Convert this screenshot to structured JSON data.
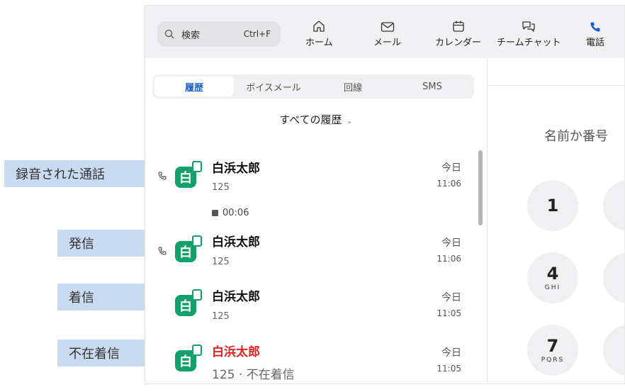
{
  "toolbar": {
    "search_label": "検索",
    "search_shortcut": "Ctrl+F",
    "nav": [
      {
        "label": "ホーム",
        "icon": "home-icon"
      },
      {
        "label": "メール",
        "icon": "mail-icon"
      },
      {
        "label": "カレンダー",
        "icon": "calendar-icon"
      },
      {
        "label": "チームチャット",
        "icon": "chat-icon"
      },
      {
        "label": "電話",
        "icon": "phone-icon",
        "active": true
      }
    ]
  },
  "tabs": [
    {
      "label": "履歴",
      "active": true
    },
    {
      "label": "ボイスメール"
    },
    {
      "label": "回線"
    },
    {
      "label": "SMS"
    }
  ],
  "filter": {
    "label": "すべての履歴"
  },
  "calls": [
    {
      "type": "recorded",
      "avatar_text": "白",
      "name": "白浜太郎",
      "number": "125",
      "day": "今日",
      "time": "11:06",
      "recording": "00:06"
    },
    {
      "type": "outgoing",
      "avatar_text": "白",
      "name": "白浜太郎",
      "number": "125",
      "day": "今日",
      "time": "11:06"
    },
    {
      "type": "incoming",
      "avatar_text": "白",
      "name": "白浜太郎",
      "number": "125",
      "day": "今日",
      "time": "11:05"
    },
    {
      "type": "missed",
      "avatar_text": "白",
      "name": "白浜太郎",
      "number": "125 · 不在着信",
      "day": "今日",
      "time": "11:05"
    }
  ],
  "dialer": {
    "placeholder": "名前か番号",
    "keys": [
      {
        "digit": "1",
        "letters": ""
      },
      {
        "digit": "4",
        "letters": "GHI"
      },
      {
        "digit": "7",
        "letters": "PQRS"
      }
    ]
  },
  "annotations": {
    "recorded": "録音された通話",
    "outgoing": "発信",
    "incoming": "着信",
    "missed": "不在着信"
  },
  "colors": {
    "accent": "#1a5fd0",
    "avatar": "#14a06a",
    "missed": "#e02424",
    "annotation": "#c9dbf1"
  }
}
